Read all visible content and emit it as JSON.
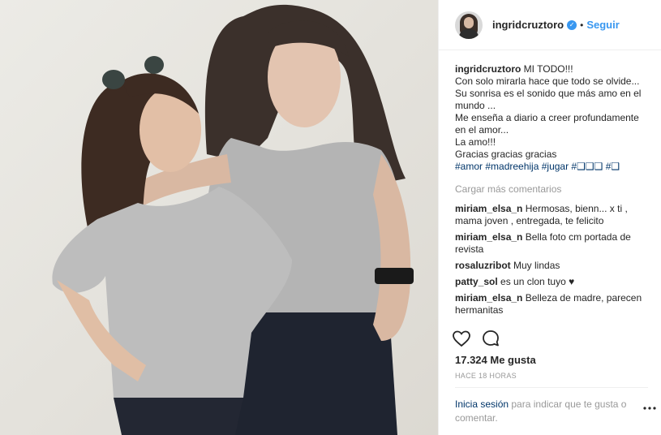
{
  "header": {
    "username": "ingridcruztoro",
    "separator": "•",
    "follow_label": "Seguir"
  },
  "caption": {
    "username": "ingridcruztoro",
    "lines": [
      "MI TODO!!!",
      "Con solo mirarla hace que todo se olvide...",
      "Su sonrisa es el sonido que más amo en el mundo ...",
      "Me enseña a diario a creer profundamente en el amor...",
      "La amo!!!",
      "Gracias gracias gracias"
    ],
    "hashtags": "#amor #madreehija #jugar #❑❑❑ #❑"
  },
  "load_more": "Cargar más comentarios",
  "comments": [
    {
      "user": "miriam_elsa_n",
      "text": "Hermosas, bienn... x ti , mama joven , entregada, te felicito"
    },
    {
      "user": "miriam_elsa_n",
      "text": "Bella foto cm portada de revista"
    },
    {
      "user": "rosaluzribot",
      "text": "Muy lindas"
    },
    {
      "user": "patty_sol",
      "text": "es un clon tuyo ♥"
    },
    {
      "user": "miriam_elsa_n",
      "text": "Belleza de madre, parecen hermanitas"
    }
  ],
  "likes": "17.324 Me gusta",
  "timestamp": "HACE 18 HORAS",
  "login": {
    "link": "Inicia sesión",
    "rest": " para indicar que te gusta o comentar."
  },
  "colors": {
    "link": "#003569",
    "accent": "#3897f0",
    "muted": "#999999"
  },
  "icons": [
    "heart-icon",
    "comment-icon",
    "more-options-icon",
    "verified-badge-icon"
  ]
}
